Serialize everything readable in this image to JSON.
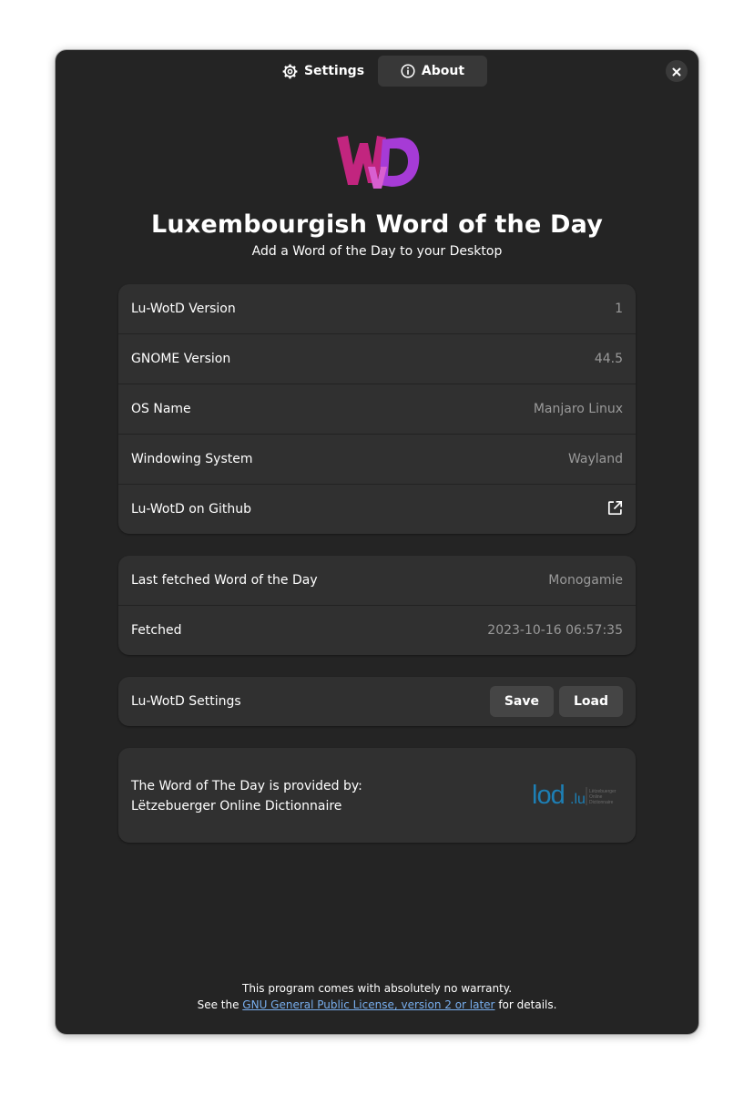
{
  "header": {
    "tabs": [
      {
        "label": "Settings",
        "icon": "gear-icon"
      },
      {
        "label": "About",
        "icon": "info-icon",
        "selected": true
      }
    ],
    "close_icon": "close-icon"
  },
  "about": {
    "logo_text": "WvD",
    "title": "Luxembourgish Word of the Day",
    "subtitle": "Add a Word of the Day to your Desktop"
  },
  "info_list": [
    {
      "title": "Lu-WotD Version",
      "value": "1"
    },
    {
      "title": "GNOME Version",
      "value": "44.5"
    },
    {
      "title": "OS Name",
      "value": "Manjaro Linux"
    },
    {
      "title": "Windowing System",
      "value": "Wayland"
    },
    {
      "title": "Lu-WotD on Github",
      "icon": "external-link-icon"
    }
  ],
  "fetch_list": [
    {
      "title": "Last fetched Word of the Day",
      "value": "Monogamie"
    },
    {
      "title": "Fetched",
      "value": "2023-10-16 06:57:35"
    }
  ],
  "settings_row": {
    "title": "Lu-WotD Settings",
    "save_label": "Save",
    "load_label": "Load"
  },
  "provider": {
    "line1": "The Word of The Day is provided by:",
    "line2": "Lëtzebuerger Online Dictionnaire",
    "logo_main": "lod",
    "logo_suffix": ".lu",
    "logo_caption": [
      "Lëtzebuerger",
      "Online",
      "Dictionnaire"
    ]
  },
  "footer": {
    "line1": "This program comes with absolutely no warranty.",
    "line2_pre": "See the ",
    "link": "GNU General Public License, version 2 or later",
    "line2_post": " for details."
  },
  "colors": {
    "window_bg": "#242424",
    "card_bg": "#303030",
    "accent_link": "#78aeed",
    "logo_pink": "#c2257f",
    "logo_purple": "#a63bd6",
    "lod_blue": "#1d7fb5"
  }
}
